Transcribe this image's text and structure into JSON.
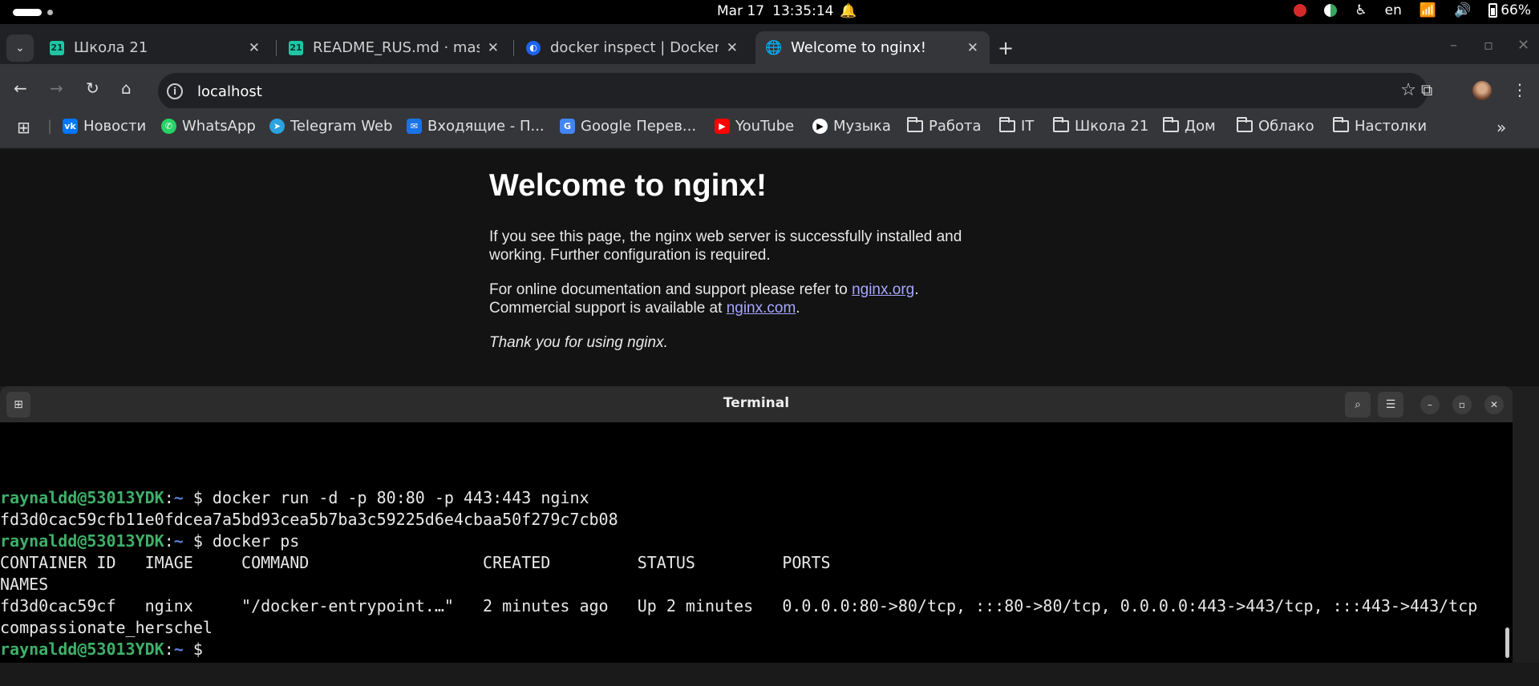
{
  "topbar": {
    "date": "Mar 17",
    "time": "13:35:14",
    "language": "en",
    "battery": "66%"
  },
  "tabs": [
    {
      "title": "Школа 21",
      "favicon": "school21-icon",
      "active": false
    },
    {
      "title": "README_RUS.md · master",
      "favicon": "school21-icon",
      "active": false
    },
    {
      "title": "docker inspect | Docker Docs",
      "favicon": "docker-icon",
      "active": false
    },
    {
      "title": "Welcome to nginx!",
      "favicon": "globe-icon",
      "active": true
    }
  ],
  "omnibox": {
    "url": "localhost"
  },
  "bookmarks": [
    {
      "label": "Новости",
      "icon": "vk-icon",
      "color": "#0077ff"
    },
    {
      "label": "WhatsApp",
      "icon": "whatsapp-icon",
      "color": "#25d366"
    },
    {
      "label": "Telegram Web",
      "icon": "telegram-icon",
      "color": "#2aa3e0"
    },
    {
      "label": "Входящие - П...",
      "icon": "mail-icon",
      "color": "#1a73e8"
    },
    {
      "label": "Google Перев...",
      "icon": "translate-icon",
      "color": "#4285f4"
    },
    {
      "label": "YouTube",
      "icon": "youtube-icon",
      "color": "#ff0000"
    },
    {
      "label": "Музыка",
      "icon": "music-icon",
      "color": "#ffffff"
    },
    {
      "label": "Работа",
      "icon": "folder-icon"
    },
    {
      "label": "IT",
      "icon": "folder-icon"
    },
    {
      "label": "Школа 21",
      "icon": "folder-icon"
    },
    {
      "label": "Дом",
      "icon": "folder-icon"
    },
    {
      "label": "Облако",
      "icon": "folder-icon"
    },
    {
      "label": "Настолки",
      "icon": "folder-icon"
    }
  ],
  "page": {
    "heading": "Welcome to nginx!",
    "p1": "If you see this page, the nginx web server is successfully installed and working. Further configuration is required.",
    "p2_pre": "For online documentation and support please refer to ",
    "p2_link": "nginx.org",
    "p2_mid": ".",
    "p2_line2": "Commercial support is available at ",
    "p2_link2": "nginx.com",
    "p2_end": ".",
    "p3": "Thank you for using nginx."
  },
  "terminal": {
    "title": "Terminal",
    "prompt_user": "raynaldd@53013YDK",
    "prompt_sep": ":",
    "prompt_dir": "~",
    "prompt_sign": " $ ",
    "cmd1": "docker run -d -p 80:80 -p 443:443 nginx",
    "out1": "fd3d0cac59cfb11e0fdcea7a5bd93cea5b7ba3c59225d6e4cbaa50f279c7cb08",
    "cmd2": "docker ps",
    "header": "CONTAINER ID   IMAGE     COMMAND                  CREATED         STATUS         PORTS",
    "header2": "NAMES",
    "row": "fd3d0cac59cf   nginx     \"/docker-entrypoint.…\"   2 minutes ago   Up 2 minutes   0.0.0.0:80->80/tcp, :::80->80/tcp, 0.0.0.0:443->443/tcp, :::443->443/tcp",
    "row2": "compassionate_herschel"
  }
}
